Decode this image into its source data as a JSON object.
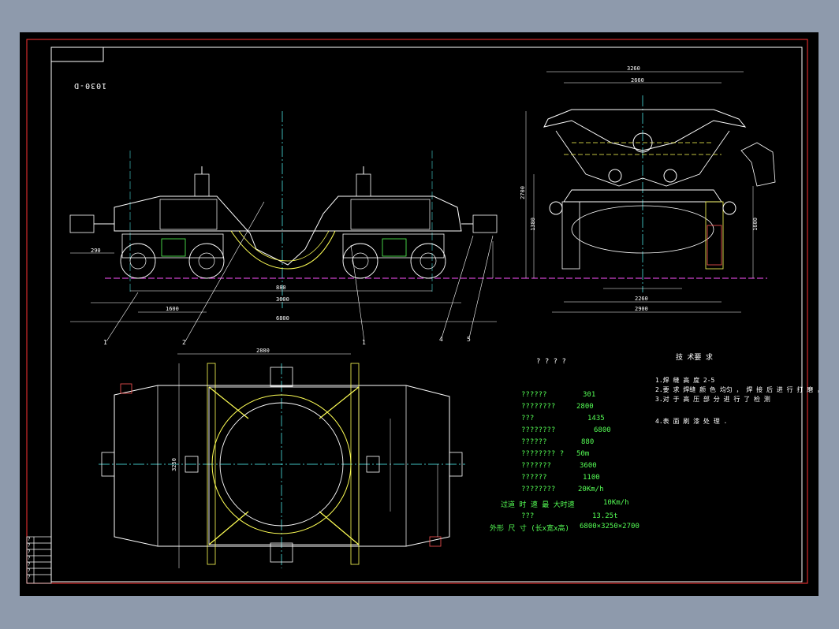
{
  "drawing_number": "1030-D",
  "tech_title": "技 术要 求",
  "tech_notes": [
    "1.焊 缝 高 度 2-5",
    "2.要 求 焊缝 颜 色 均匀 ， 焊 接 后 进 行 打 磨 ，",
    "3.对 于 高 压 部 分 进 行 了 检 测",
    "4.表 面 刷 漆 处 理 ."
  ],
  "spec_header": "? ? ? ?",
  "specs": [
    {
      "key": "??????",
      "value": "301"
    },
    {
      "key": "????????",
      "value": "2800"
    },
    {
      "key": "???",
      "value": "1435"
    },
    {
      "key": "????????",
      "value": "6800"
    },
    {
      "key": "??????",
      "value": "880"
    },
    {
      "key": "???????? ?",
      "value": "50m"
    },
    {
      "key": "???????",
      "value": "3600"
    },
    {
      "key": "??????",
      "value": "1100"
    },
    {
      "key": "????????",
      "value": "20Km/h"
    },
    {
      "key": "过道 时 速 最 大时速",
      "value": "10Km/h"
    },
    {
      "key": "???",
      "value": "13.25t"
    },
    {
      "key": "外形 尺 寸 (长x宽x高)",
      "value": "6800×3250×2700"
    }
  ],
  "balloons": [
    "1",
    "2",
    "1",
    "4",
    "5"
  ],
  "dims": {
    "side_top": "3260",
    "side_top2": "2660",
    "side_height": "2700",
    "side_h2": "1380",
    "side_h3": "1600",
    "side_base": "2260",
    "side_base2": "2900",
    "front_left": "290",
    "front_overall": "6800",
    "front_center": "3600",
    "front_wheel": "1600",
    "front_sub": "880",
    "plan_top": "2880",
    "plan_left": "3250"
  },
  "title_block_rows": [
    "?",
    "?",
    "?",
    "?",
    "?",
    "?",
    "?"
  ]
}
